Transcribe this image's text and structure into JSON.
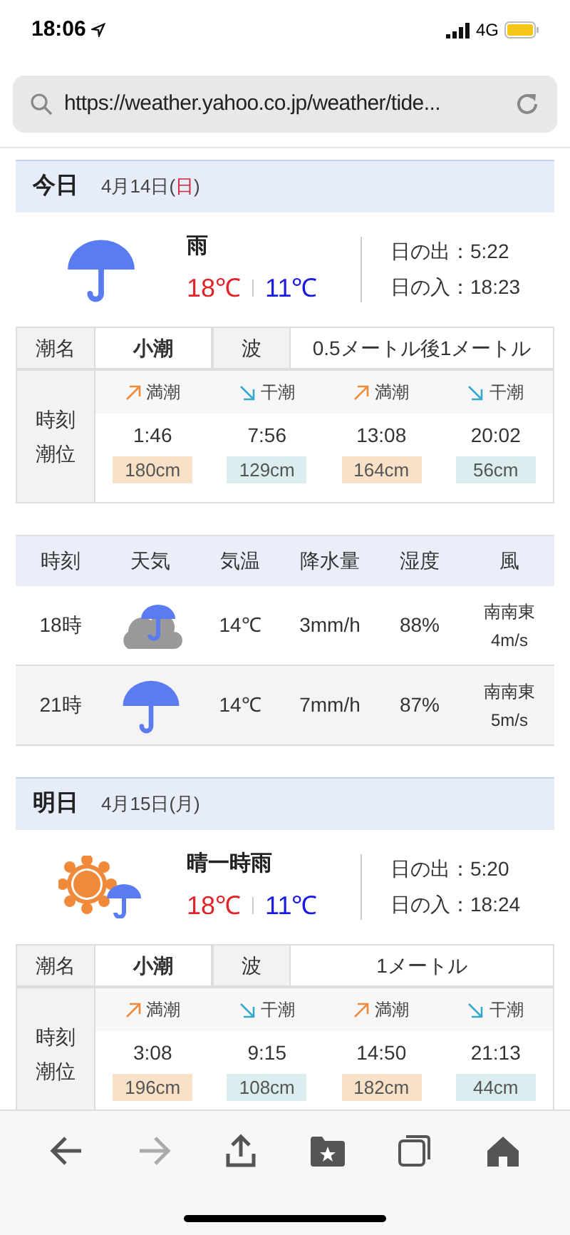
{
  "status_bar": {
    "time": "18:06",
    "network": "4G"
  },
  "url_bar": {
    "url": "https://weather.yahoo.co.jp/weather/tide..."
  },
  "days": [
    {
      "label": "今日",
      "date": "4月14日(",
      "weekday": "日",
      "date_end": ")",
      "weekday_red": true,
      "weather": {
        "kind": "rain",
        "text": "雨",
        "high": "18℃",
        "low": "11℃"
      },
      "sunrise": "日の出：5:22",
      "sunset": "日の入：18:23",
      "tide": {
        "name_label": "潮名",
        "name": "小潮",
        "wave_label": "波",
        "wave": "0.5メートル後1メートル",
        "time_label": "時刻",
        "level_label": "潮位",
        "events": [
          {
            "kind": "high",
            "label": "満潮",
            "time": "1:46",
            "height": "180cm"
          },
          {
            "kind": "low",
            "label": "干潮",
            "time": "7:56",
            "height": "129cm"
          },
          {
            "kind": "high",
            "label": "満潮",
            "time": "13:08",
            "height": "164cm"
          },
          {
            "kind": "low",
            "label": "干潮",
            "time": "20:02",
            "height": "56cm"
          }
        ]
      },
      "hourly": {
        "columns": [
          "時刻",
          "天気",
          "気温",
          "降水量",
          "湿度",
          "風"
        ],
        "rows": [
          {
            "time": "18時",
            "kind": "cloud_rain",
            "temp": "14℃",
            "precip": "3mm/h",
            "humidity": "88%",
            "wind_dir": "南南東",
            "wind_speed": "4m/s"
          },
          {
            "time": "21時",
            "kind": "rain",
            "temp": "14℃",
            "precip": "7mm/h",
            "humidity": "87%",
            "wind_dir": "南南東",
            "wind_speed": "5m/s"
          }
        ]
      }
    },
    {
      "label": "明日",
      "date": "4月15日(",
      "weekday": "月",
      "date_end": ")",
      "weekday_red": false,
      "weather": {
        "kind": "sun_rain",
        "text": "晴一時雨",
        "high": "18℃",
        "low": "11℃"
      },
      "sunrise": "日の出：5:20",
      "sunset": "日の入：18:24",
      "tide": {
        "name_label": "潮名",
        "name": "小潮",
        "wave_label": "波",
        "wave": "1メートル",
        "time_label": "時刻",
        "level_label": "潮位",
        "events": [
          {
            "kind": "high",
            "label": "満潮",
            "time": "3:08",
            "height": "196cm"
          },
          {
            "kind": "low",
            "label": "干潮",
            "time": "9:15",
            "height": "108cm"
          },
          {
            "kind": "high",
            "label": "満潮",
            "time": "14:50",
            "height": "182cm"
          },
          {
            "kind": "low",
            "label": "干潮",
            "time": "21:13",
            "height": "44cm"
          }
        ]
      }
    }
  ]
}
